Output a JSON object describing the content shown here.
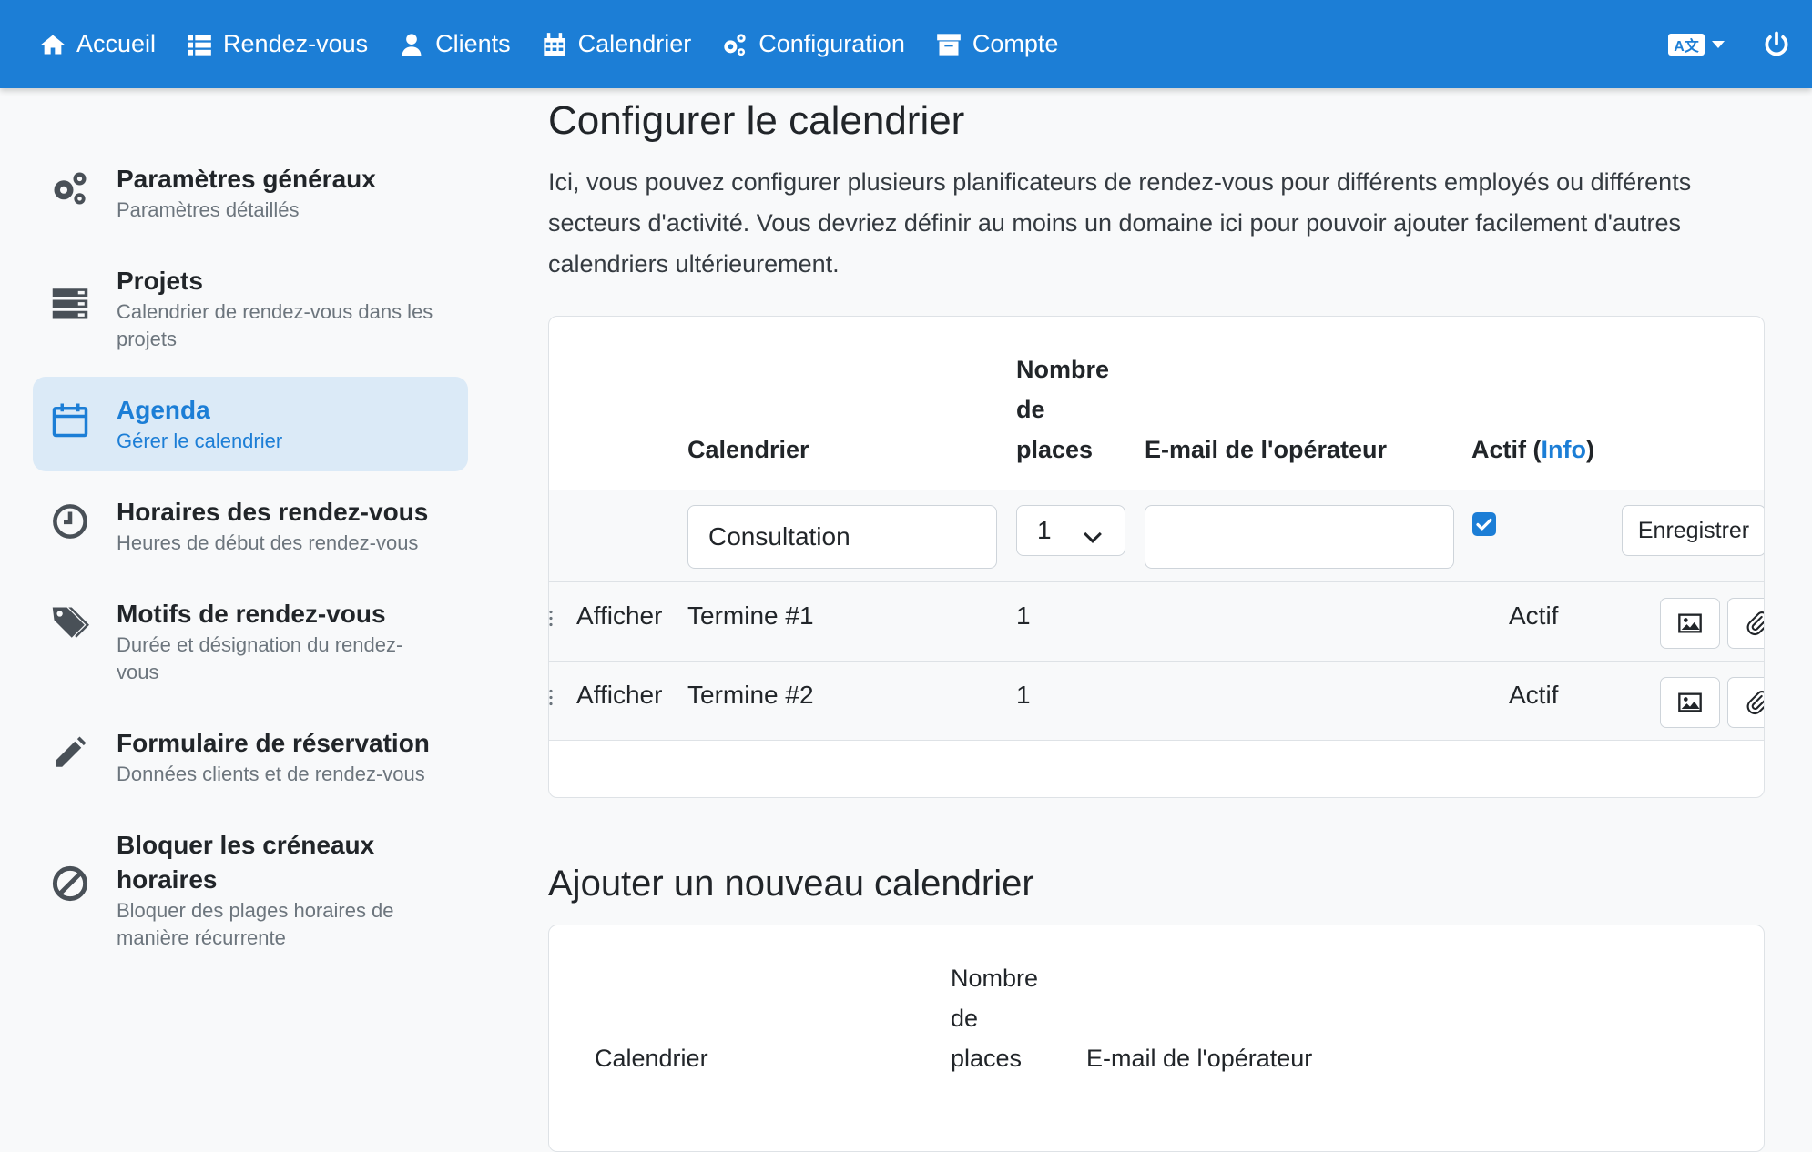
{
  "nav": {
    "items": [
      {
        "label": "Accueil",
        "icon": "home-icon"
      },
      {
        "label": "Rendez-vous",
        "icon": "list-icon"
      },
      {
        "label": "Clients",
        "icon": "user-icon"
      },
      {
        "label": "Calendrier",
        "icon": "calendar-icon"
      },
      {
        "label": "Configuration",
        "icon": "gears-icon"
      },
      {
        "label": "Compte",
        "icon": "archive-icon"
      }
    ],
    "language_icon": "language-icon",
    "language_badge": "A文",
    "power_icon": "power-icon"
  },
  "sidebar": {
    "items": [
      {
        "title": "Paramètres généraux",
        "sub": "Paramètres détaillés",
        "icon": "gears-icon"
      },
      {
        "title": "Projets",
        "sub": "Calendrier de rendez-vous dans les projets",
        "icon": "server-icon"
      },
      {
        "title": "Agenda",
        "sub": "Gérer le calendrier",
        "icon": "calendar-icon",
        "active": true
      },
      {
        "title": "Horaires des rendez-vous",
        "sub": "Heures de début des rendez-vous",
        "icon": "clock-icon"
      },
      {
        "title": "Motifs de rendez-vous",
        "sub": "Durée et désignation du rendez-vous",
        "icon": "tags-icon"
      },
      {
        "title": "Formulaire de réservation",
        "sub": "Données clients et de rendez-vous",
        "icon": "pencil-icon"
      },
      {
        "title": "Bloquer les créneaux horaires",
        "sub": "Bloquer des plages horaires de manière récurrente",
        "icon": "ban-icon"
      }
    ]
  },
  "main": {
    "title": "Configurer le calendrier",
    "intro": "Ici, vous pouvez configurer plusieurs planificateurs de rendez-vous pour différents employés ou différents secteurs d'activité. Vous devriez définir au moins un domaine ici pour pouvoir ajouter facilement d'autres calendriers ultérieurement.",
    "table": {
      "headers": {
        "calendar": "Calendrier",
        "places_1": "Nombre",
        "places_2": "de",
        "places_3": "places",
        "email": "E-mail de l'opérateur",
        "active_prefix": "Actif (",
        "active_link": "Info",
        "active_suffix": ")"
      },
      "edit_row": {
        "calendar_value": "Consultation",
        "places_value": "1",
        "email_value": "",
        "active_checked": true,
        "save_label": "Enregistrer"
      },
      "rows": [
        {
          "link": "Afficher",
          "name": "Termine #1",
          "places": "1",
          "email": "",
          "status": "Actif"
        },
        {
          "link": "Afficher",
          "name": "Termine #2",
          "places": "1",
          "email": "",
          "status": "Actif"
        }
      ]
    },
    "add_title": "Ajouter un nouveau calendrier",
    "add_table": {
      "headers": {
        "calendar": "Calendrier",
        "places_1": "Nombre",
        "places_2": "de",
        "places_3": "places",
        "email": "E-mail de l'opérateur"
      }
    }
  },
  "colors": {
    "primary": "#1c7ed6",
    "active_bg": "#dbeaf7",
    "page_bg": "#f8f9fa"
  }
}
